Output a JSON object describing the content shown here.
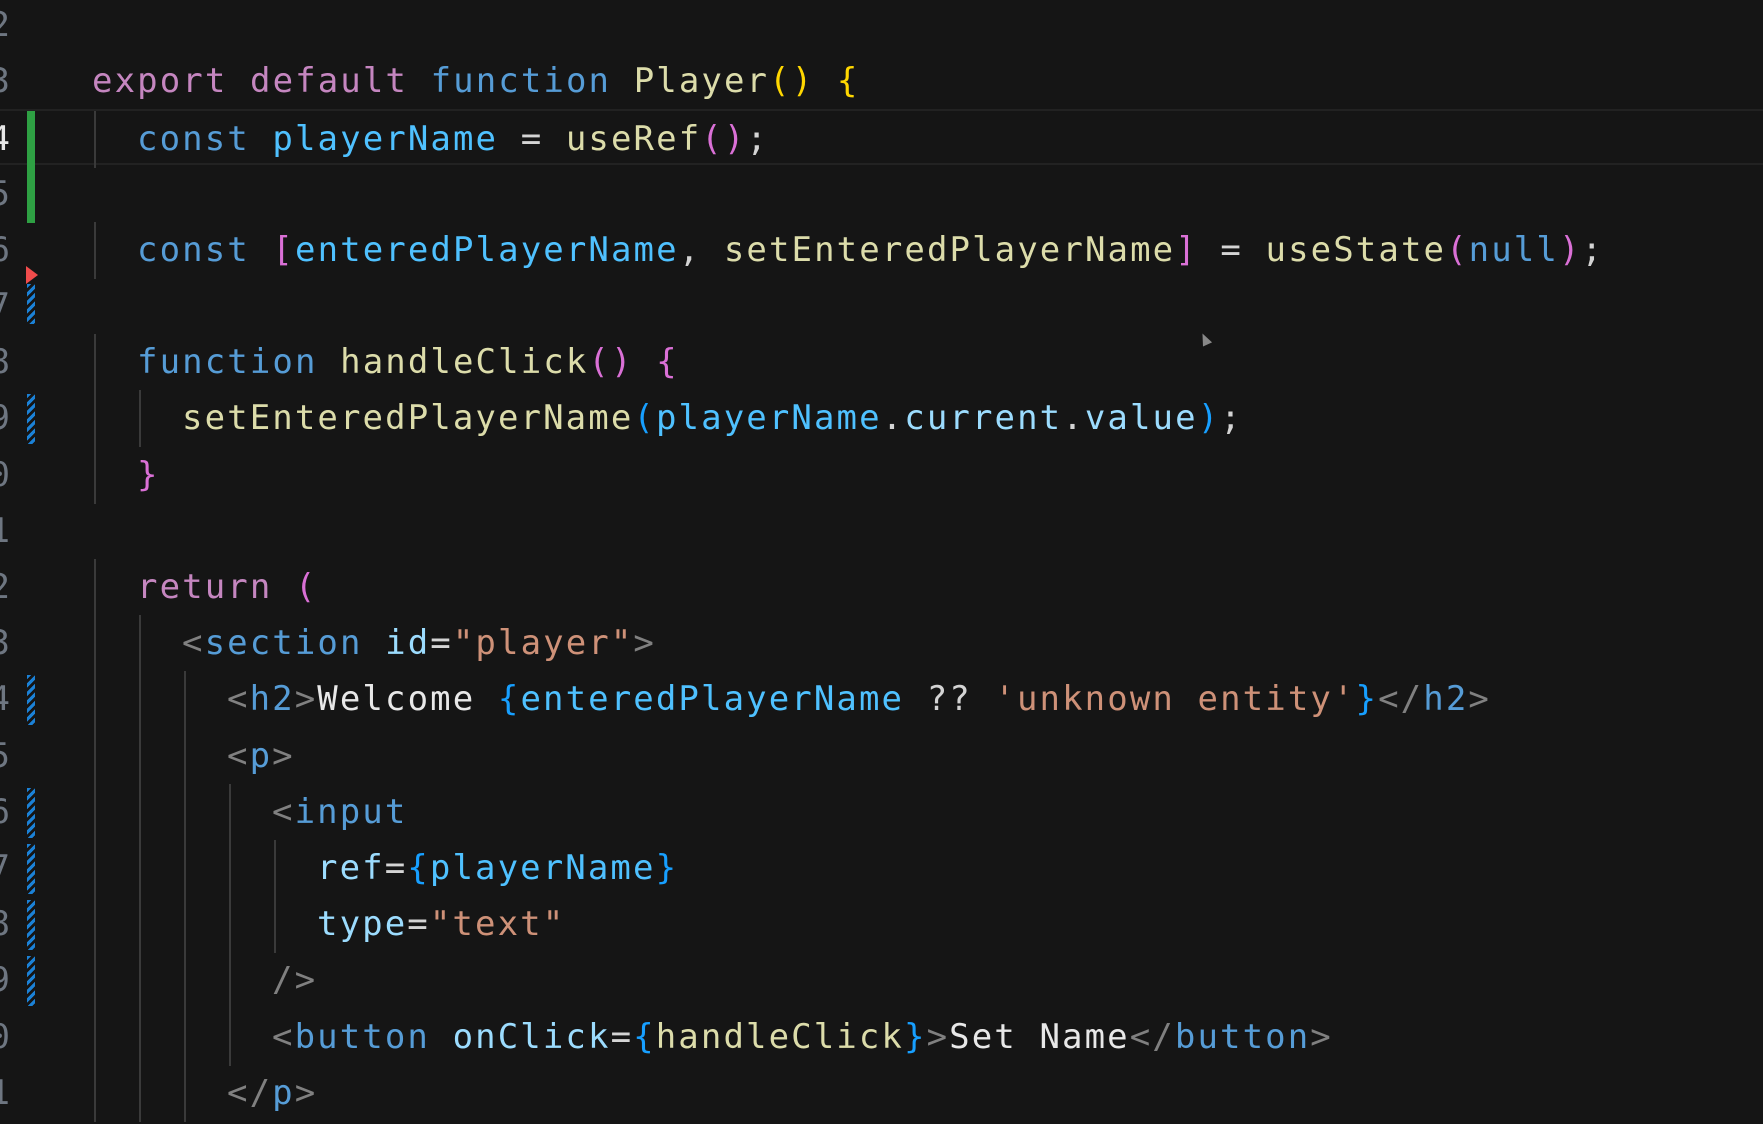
{
  "editor": {
    "language": "jsx",
    "active_line_index": 2,
    "colors": {
      "background": "#151515",
      "keyword": "#c586c0",
      "storage": "#569cd6",
      "function": "#dcdcaa",
      "variable": "#9cdcfe",
      "constant": "#4fc1ff",
      "string": "#ce9178",
      "added_gutter": "#2ea043",
      "modified_gutter": "#1b81d6",
      "deleted_gutter": "#f14c4c"
    },
    "lines": [
      {
        "num": "2",
        "indent": 0,
        "tokens": []
      },
      {
        "num": "3",
        "indent": 0,
        "tokens": [
          [
            "export ",
            "kw"
          ],
          [
            "default ",
            "kw"
          ],
          [
            "function ",
            "bl"
          ],
          [
            "Player",
            "fn"
          ],
          [
            "() ",
            "gold"
          ],
          [
            "{",
            "gold"
          ]
        ]
      },
      {
        "num": "4",
        "indent": 1,
        "gutter": "added",
        "tokens": [
          [
            "const ",
            "bl"
          ],
          [
            "playerName",
            "cst"
          ],
          [
            " = ",
            "tx"
          ],
          [
            "useRef",
            "fn"
          ],
          [
            "()",
            "pink"
          ],
          [
            ";",
            "tx"
          ]
        ]
      },
      {
        "num": "5",
        "indent": 0,
        "gutter": "added",
        "tokens": []
      },
      {
        "num": "6",
        "indent": 1,
        "tokens": [
          [
            "const ",
            "bl"
          ],
          [
            "[",
            "pink"
          ],
          [
            "enteredPlayerName",
            "cst"
          ],
          [
            ", ",
            "tx"
          ],
          [
            "setEnteredPlayerName",
            "fn"
          ],
          [
            "]",
            "pink"
          ],
          [
            " = ",
            "tx"
          ],
          [
            "useState",
            "fn"
          ],
          [
            "(",
            "pink"
          ],
          [
            "null",
            "bl"
          ],
          [
            ")",
            "pink"
          ],
          [
            ";",
            "tx"
          ]
        ]
      },
      {
        "num": "7",
        "indent": 0,
        "gutter": "deleted-modified",
        "tokens": []
      },
      {
        "num": "8",
        "indent": 1,
        "tokens": [
          [
            "function ",
            "bl"
          ],
          [
            "handleClick",
            "fn"
          ],
          [
            "() ",
            "pink"
          ],
          [
            "{",
            "pink"
          ]
        ]
      },
      {
        "num": "9",
        "indent": 2,
        "gutter": "modified",
        "tokens": [
          [
            "setEnteredPlayerName",
            "fn"
          ],
          [
            "(",
            "bb"
          ],
          [
            "playerName",
            "cst"
          ],
          [
            ".",
            "tx"
          ],
          [
            "current",
            "var"
          ],
          [
            ".",
            "tx"
          ],
          [
            "value",
            "var"
          ],
          [
            ")",
            "bb"
          ],
          [
            ";",
            "tx"
          ]
        ]
      },
      {
        "num": "0",
        "indent": 1,
        "tokens": [
          [
            "}",
            "pink"
          ]
        ]
      },
      {
        "num": "1",
        "indent": 0,
        "tokens": []
      },
      {
        "num": "2",
        "indent": 1,
        "tokens": [
          [
            "return ",
            "kw"
          ],
          [
            "(",
            "pink"
          ]
        ]
      },
      {
        "num": "3",
        "indent": 2,
        "tokens": [
          [
            "<",
            "tag"
          ],
          [
            "section ",
            "bl"
          ],
          [
            "id",
            "var"
          ],
          [
            "=",
            "tx"
          ],
          [
            "\"player\"",
            "str"
          ],
          [
            ">",
            "tag"
          ]
        ]
      },
      {
        "num": "4",
        "indent": 3,
        "gutter": "modified",
        "tokens": [
          [
            "<",
            "tag"
          ],
          [
            "h2",
            "bl"
          ],
          [
            ">",
            "tag"
          ],
          [
            "Welcome ",
            "wt"
          ],
          [
            "{",
            "bb"
          ],
          [
            "enteredPlayerName",
            "cst"
          ],
          [
            " ?? ",
            "tx"
          ],
          [
            "'unknown entity'",
            "str"
          ],
          [
            "}",
            "bb"
          ],
          [
            "</",
            "tag"
          ],
          [
            "h2",
            "bl"
          ],
          [
            ">",
            "tag"
          ]
        ]
      },
      {
        "num": "5",
        "indent": 3,
        "tokens": [
          [
            "<",
            "tag"
          ],
          [
            "p",
            "bl"
          ],
          [
            ">",
            "tag"
          ]
        ]
      },
      {
        "num": "6",
        "indent": 4,
        "gutter": "modified",
        "tokens": [
          [
            "<",
            "tag"
          ],
          [
            "input",
            "bl"
          ]
        ]
      },
      {
        "num": "7",
        "indent": 5,
        "gutter": "modified",
        "tokens": [
          [
            "ref",
            "var"
          ],
          [
            "=",
            "tx"
          ],
          [
            "{",
            "bb"
          ],
          [
            "playerName",
            "cst"
          ],
          [
            "}",
            "bb"
          ]
        ]
      },
      {
        "num": "8",
        "indent": 5,
        "gutter": "modified",
        "tokens": [
          [
            "type",
            "var"
          ],
          [
            "=",
            "tx"
          ],
          [
            "\"text\"",
            "str"
          ]
        ]
      },
      {
        "num": "9",
        "indent": 4,
        "gutter": "modified",
        "tokens": [
          [
            "/>",
            "tag"
          ]
        ]
      },
      {
        "num": "0",
        "indent": 4,
        "tokens": [
          [
            "<",
            "tag"
          ],
          [
            "button ",
            "bl"
          ],
          [
            "onClick",
            "var"
          ],
          [
            "=",
            "tx"
          ],
          [
            "{",
            "bb"
          ],
          [
            "handleClick",
            "fn"
          ],
          [
            "}",
            "bb"
          ],
          [
            ">",
            "tag"
          ],
          [
            "Set Name",
            "wt"
          ],
          [
            "</",
            "tag"
          ],
          [
            "button",
            "bl"
          ],
          [
            ">",
            "tag"
          ]
        ]
      },
      {
        "num": "1",
        "indent": 3,
        "tokens": [
          [
            "</",
            "tag"
          ],
          [
            "p",
            "bl"
          ],
          [
            ">",
            "tag"
          ]
        ]
      }
    ]
  }
}
